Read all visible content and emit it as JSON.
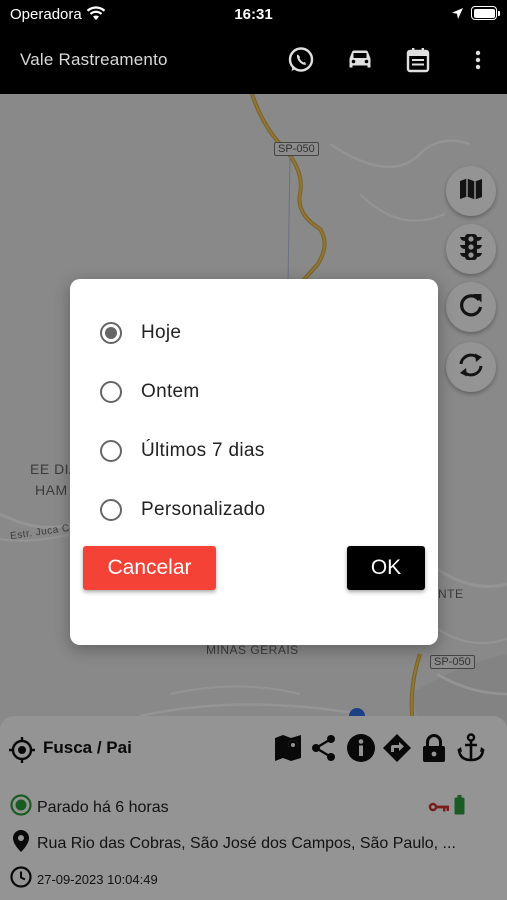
{
  "status_bar": {
    "carrier": "Operadora",
    "time": "16:31",
    "icons": [
      "wifi-icon",
      "location-arrow-icon",
      "battery-icon"
    ]
  },
  "app_bar": {
    "title": "Vale Rastreamento",
    "actions": [
      "whatsapp-icon",
      "car-icon",
      "calendar-icon",
      "more-vert-icon"
    ]
  },
  "map": {
    "labels": {
      "school_line1": "EE DIA",
      "school_line2": "HAM",
      "street": "Estr. Juca C",
      "district": "MINAS GERAIS",
      "area_right": "NTE"
    },
    "road_shields": [
      "SP-050",
      "SP-050"
    ],
    "fab_buttons": [
      "map-icon",
      "traffic-light-icon",
      "refresh-icon",
      "sync-icon"
    ]
  },
  "dialog": {
    "options": [
      {
        "label": "Hoje",
        "selected": true
      },
      {
        "label": "Ontem",
        "selected": false
      },
      {
        "label": "Últimos 7 dias",
        "selected": false
      },
      {
        "label": "Personalizado",
        "selected": false
      }
    ],
    "cancel_label": "Cancelar",
    "ok_label": "OK"
  },
  "vehicle_panel": {
    "name": "Fusca / Pai",
    "actions": [
      "geofence-icon",
      "share-icon",
      "info-icon",
      "directions-icon",
      "lock-icon",
      "anchor-icon"
    ],
    "status": "Parado há 6 horas",
    "address": "Rua Rio das Cobras, São José dos Campos, São Paulo, ...",
    "timestamp": "27-09-2023 10:04:49",
    "colors": {
      "status_ok": "#2e9e3e",
      "ignition_key": "#d32f2f",
      "battery": "#2e9e3e"
    }
  },
  "colors": {
    "cancel_button": "#f44336",
    "ok_button": "#000000",
    "app_bar": "#000000"
  }
}
